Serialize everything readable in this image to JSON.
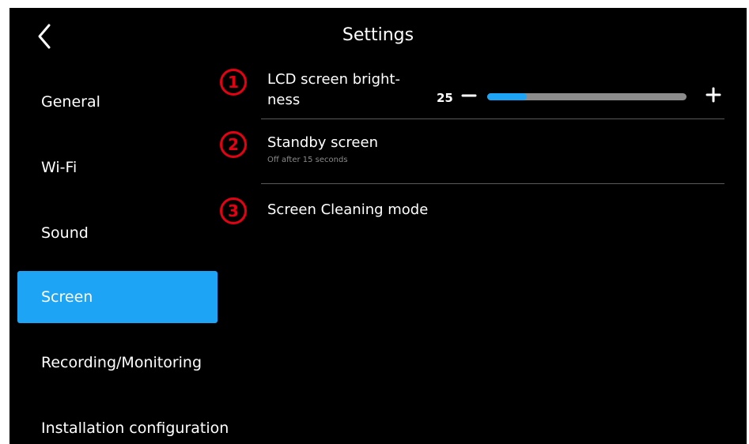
{
  "header": {
    "title": "Settings",
    "back_icon": "chevron-left-icon"
  },
  "sidebar": {
    "items": [
      {
        "label": "General",
        "active": false
      },
      {
        "label": "Wi-Fi",
        "active": false
      },
      {
        "label": "Sound",
        "active": false
      },
      {
        "label": "Screen",
        "active": true
      },
      {
        "label": "Recording/Monitoring",
        "active": false
      },
      {
        "label": "Installation configuration",
        "active": false
      }
    ]
  },
  "settings": {
    "items": [
      {
        "number": "1",
        "title_line1": "LCD screen bright-",
        "title_line2": "ness"
      },
      {
        "number": "2",
        "title": "Standby screen",
        "subtitle": "Off after 15 seconds"
      },
      {
        "number": "3",
        "title": "Screen Cleaning mode"
      }
    ],
    "brightness": {
      "value": "25",
      "fraction": 0.2,
      "minus_icon": "minus-icon",
      "plus_icon": "plus-icon"
    }
  },
  "colors": {
    "background": "#000000",
    "accent": "#1ea4f5",
    "annotation": "#e60012",
    "divider": "#5a5a5a",
    "slider_track": "#8c8c8c",
    "subtitle": "#8a8a8a"
  }
}
